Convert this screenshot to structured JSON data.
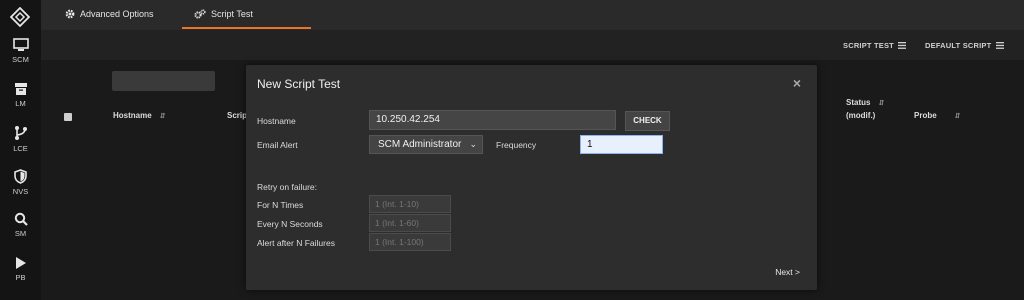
{
  "sidebar": {
    "items": [
      {
        "label": "SCM",
        "icon": "monitor-icon"
      },
      {
        "label": "LM",
        "icon": "archive-icon"
      },
      {
        "label": "LCE",
        "icon": "branch-icon"
      },
      {
        "label": "NVS",
        "icon": "shield-icon"
      },
      {
        "label": "SM",
        "icon": "search-icon"
      },
      {
        "label": "PB",
        "icon": "play-icon"
      }
    ]
  },
  "tabs": [
    {
      "label": "Advanced Options",
      "icon": "gear-icon"
    },
    {
      "label": "Script Test",
      "icon": "gears-icon",
      "active": true
    }
  ],
  "toolbar": {
    "script_test_label": "SCRIPT TEST",
    "default_script_label": "DEFAULT SCRIPT"
  },
  "table": {
    "headers": {
      "hostname": "Hostname",
      "script": "Scrip",
      "status_line1": "Status",
      "status_line2": "(modif.)",
      "probe": "Probe"
    }
  },
  "modal": {
    "title": "New Script Test",
    "close": "×",
    "hostname_label": "Hostname",
    "hostname_value": "10.250.42.254",
    "check_label": "CHECK",
    "email_alert_label": "Email Alert",
    "email_alert_value": "SCM Administrator",
    "frequency_label": "Frequency",
    "frequency_value": "1",
    "retry_label": "Retry on failure:",
    "n_times_label": "For N Times",
    "n_times_placeholder": "1 (Int. 1-10)",
    "n_seconds_label": "Every N Seconds",
    "n_seconds_placeholder": "1 (Int. 1-60)",
    "n_failures_label": "Alert after N Failures",
    "n_failures_placeholder": "1 (Int. 1-100)",
    "next_label": "Next >"
  },
  "colors": {
    "accent": "#e8752a",
    "background": "#1b1b1b",
    "modal": "#2d2d2d"
  }
}
